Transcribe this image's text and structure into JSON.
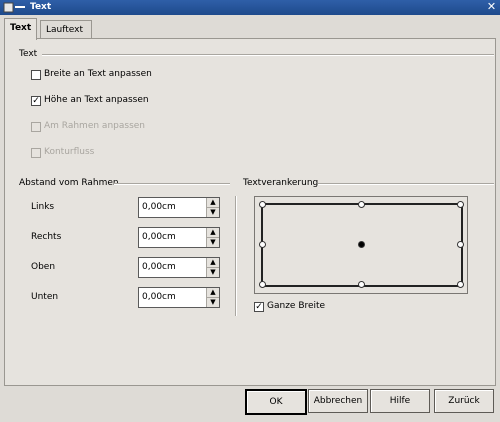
{
  "window": {
    "title": "Text",
    "close_glyph": "✕"
  },
  "tabs": [
    {
      "label": "Text",
      "active": true
    },
    {
      "label": "Lauftext",
      "active": false
    }
  ],
  "text_group": {
    "title": "Text",
    "options": [
      {
        "label": "Breite an Text anpassen",
        "checked": false,
        "enabled": true
      },
      {
        "label": "Höhe an Text anpassen",
        "checked": true,
        "enabled": true
      },
      {
        "label": "Am Rahmen anpassen",
        "checked": false,
        "enabled": false
      },
      {
        "label": "Konturfluss",
        "checked": false,
        "enabled": false
      }
    ]
  },
  "spacing_group": {
    "title": "Abstand vom Rahmen",
    "fields": [
      {
        "label": "Links",
        "value": "0,00cm"
      },
      {
        "label": "Rechts",
        "value": "0,00cm"
      },
      {
        "label": "Oben",
        "value": "0,00cm"
      },
      {
        "label": "Unten",
        "value": "0,00cm"
      }
    ],
    "up_glyph": "▲",
    "down_glyph": "▼"
  },
  "anchor_group": {
    "title": "Textverankerung",
    "selected": "center",
    "full_width": {
      "label": "Ganze Breite",
      "checked": true
    }
  },
  "check_glyph": "✓",
  "buttons": {
    "ok": "OK",
    "cancel": "Abbrechen",
    "help": "Hilfe",
    "reset": "Zurück"
  }
}
